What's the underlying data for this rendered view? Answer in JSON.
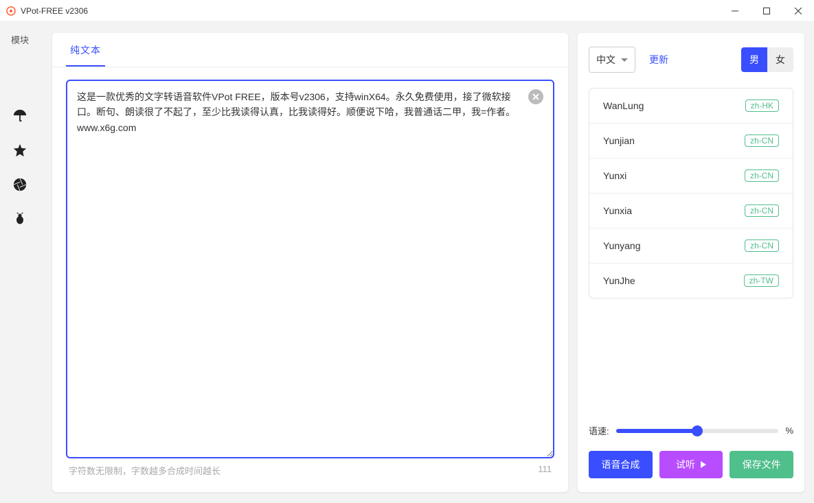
{
  "title": "VPot-FREE v2306",
  "sidebar_label": "模块",
  "tab_label": "纯文本",
  "textarea_value": "这是一款优秀的文字转语音软件VPot FREE，版本号v2306，支持winX64。永久免费使用，接了微软接口。断句、朗读很了不起了，至少比我读得认真，比我读得好。顺便说下哈，我普通话二甲，我=作者。www.x6g.com",
  "footer_hint": "字符数无限制，字数越多合成时间越长",
  "char_count": "111",
  "lang_label": "中文",
  "update_label": "更新",
  "gender": {
    "male": "男",
    "female": "女"
  },
  "voices": [
    {
      "name": "WanLung",
      "locale": "zh-HK"
    },
    {
      "name": "Yunjian",
      "locale": "zh-CN"
    },
    {
      "name": "Yunxi",
      "locale": "zh-CN"
    },
    {
      "name": "Yunxia",
      "locale": "zh-CN"
    },
    {
      "name": "Yunyang",
      "locale": "zh-CN"
    },
    {
      "name": "YunJhe",
      "locale": "zh-TW"
    }
  ],
  "speed_label": "语速:",
  "speed_unit": "%",
  "buttons": {
    "synth": "语音合成",
    "preview": "试听",
    "save": "保存文件"
  }
}
